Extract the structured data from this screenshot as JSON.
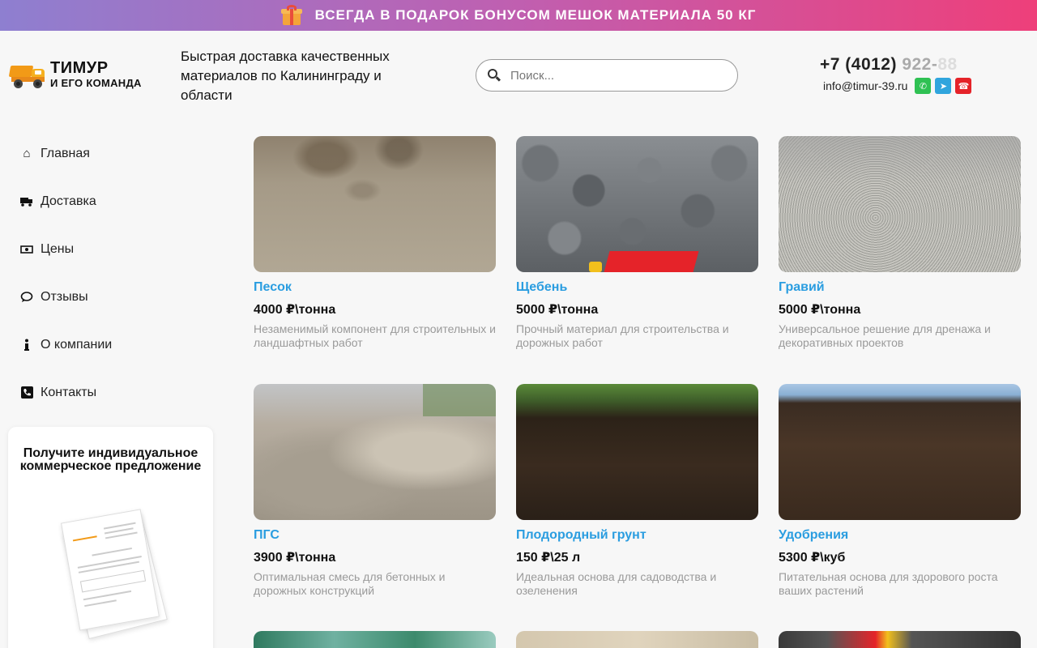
{
  "promo": {
    "text": "ВСЕГДА В ПОДАРОК БОНУСОМ МЕШОК МАТЕРИАЛА 50 КГ",
    "icon": "gift-icon"
  },
  "header": {
    "logo_line1": "ТИМУР",
    "logo_line2": "И ЕГО КОМАНДА",
    "tagline": "Быстрая доставка качественных материалов по Калининграду и области",
    "search_placeholder": "Поиск...",
    "phone_main": "+7 (4012)",
    "phone_fade": "922-",
    "phone_fade2": "88",
    "email": "info@timur-39.ru",
    "social": [
      "whatsapp-icon",
      "telegram-icon",
      "phone-icon"
    ]
  },
  "nav": {
    "items": [
      {
        "label": "Главная",
        "icon": "home-icon"
      },
      {
        "label": "Доставка",
        "icon": "truck-icon"
      },
      {
        "label": "Цены",
        "icon": "money-icon"
      },
      {
        "label": "Отзывы",
        "icon": "comment-icon"
      },
      {
        "label": "О компании",
        "icon": "info-icon"
      },
      {
        "label": "Контакты",
        "icon": "phone-square-icon"
      }
    ]
  },
  "offer": {
    "title": "Получите индивидуальное коммерческое предложение"
  },
  "products": [
    {
      "name": "Песок",
      "price": "4000 ₽\\тонна",
      "desc": "Незаменимый компонент для строительных и ландшафтных работ"
    },
    {
      "name": "Щебень",
      "price": "5000 ₽\\тонна",
      "desc": "Прочный материал для строительства и дорожных работ"
    },
    {
      "name": "Гравий",
      "price": "5000 ₽\\тонна",
      "desc": "Универсальное решение для дренажа и декоративных проектов"
    },
    {
      "name": "ПГС",
      "price": "3900 ₽\\тонна",
      "desc": "Оптимальная смесь для бетонных и дорожных конструкций"
    },
    {
      "name": "Плодородный грунт",
      "price": "150 ₽\\25 л",
      "desc": "Идеальная основа для садоводства и озеленения"
    },
    {
      "name": "Удобрения",
      "price": "5300 ₽\\куб",
      "desc": "Питательная основа для здорового роста ваших растений"
    }
  ],
  "colors": {
    "accent": "#2a9de0",
    "promo_start": "#8e7fd0",
    "promo_end": "#ee3f7a"
  }
}
